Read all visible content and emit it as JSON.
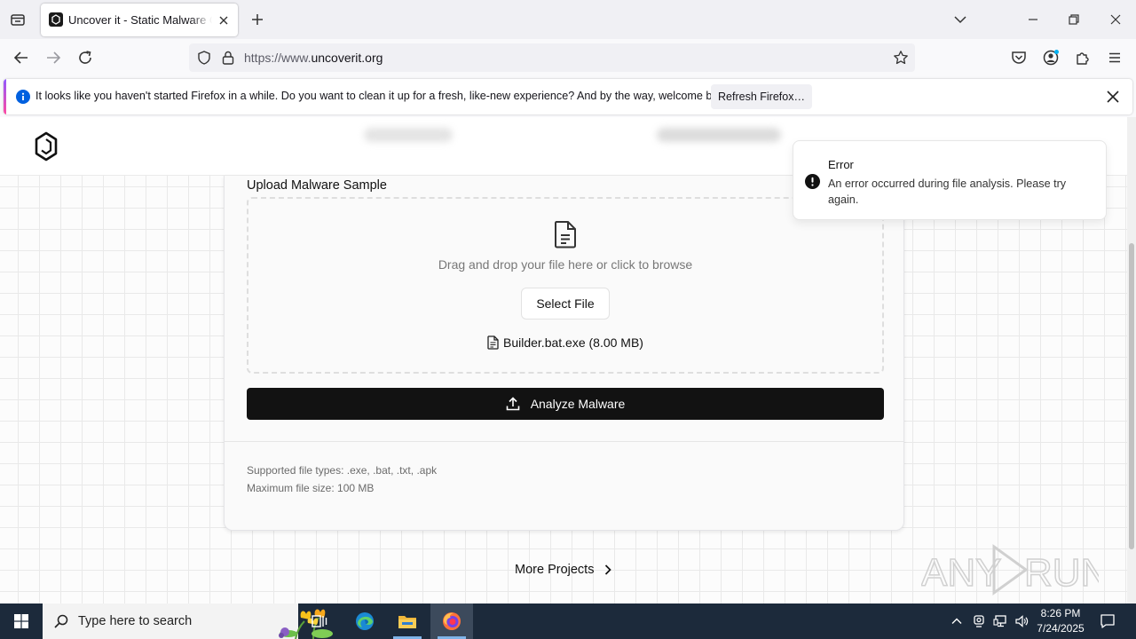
{
  "browser": {
    "tab_title": "Uncover it - Static Malware Con",
    "url_prefix": "https://www.",
    "url_host": "uncoverit.org"
  },
  "notification": {
    "message": "It looks like you haven't started Firefox in a while. Do you want to clean it up for a fresh, like-new experience? And by the way, welcome back!",
    "button_label": "Refresh Firefox…"
  },
  "upload": {
    "section_label": "Upload Malware Sample",
    "drop_text": "Drag and drop your file here or click to browse",
    "select_label": "Select File",
    "file_name": "Builder.bat.exe (8.00 MB)",
    "analyze_label": "Analyze Malware",
    "supported": "Supported file types: .exe, .bat, .txt, .apk",
    "max_size": "Maximum file size: 100 MB"
  },
  "footer": {
    "more_projects": "More Projects"
  },
  "toast": {
    "title": "Error",
    "message": "An error occurred during file analysis. Please try again."
  },
  "watermark": {
    "text_left": "ANY",
    "text_right": "RUN"
  },
  "taskbar": {
    "search_placeholder": "Type here to search",
    "time": "8:26 PM",
    "date": "7/24/2025"
  },
  "colors": {
    "accent_dark": "#121212",
    "firefox_info_blue": "#0060df",
    "taskbar_bg": "#1c2a3b"
  }
}
